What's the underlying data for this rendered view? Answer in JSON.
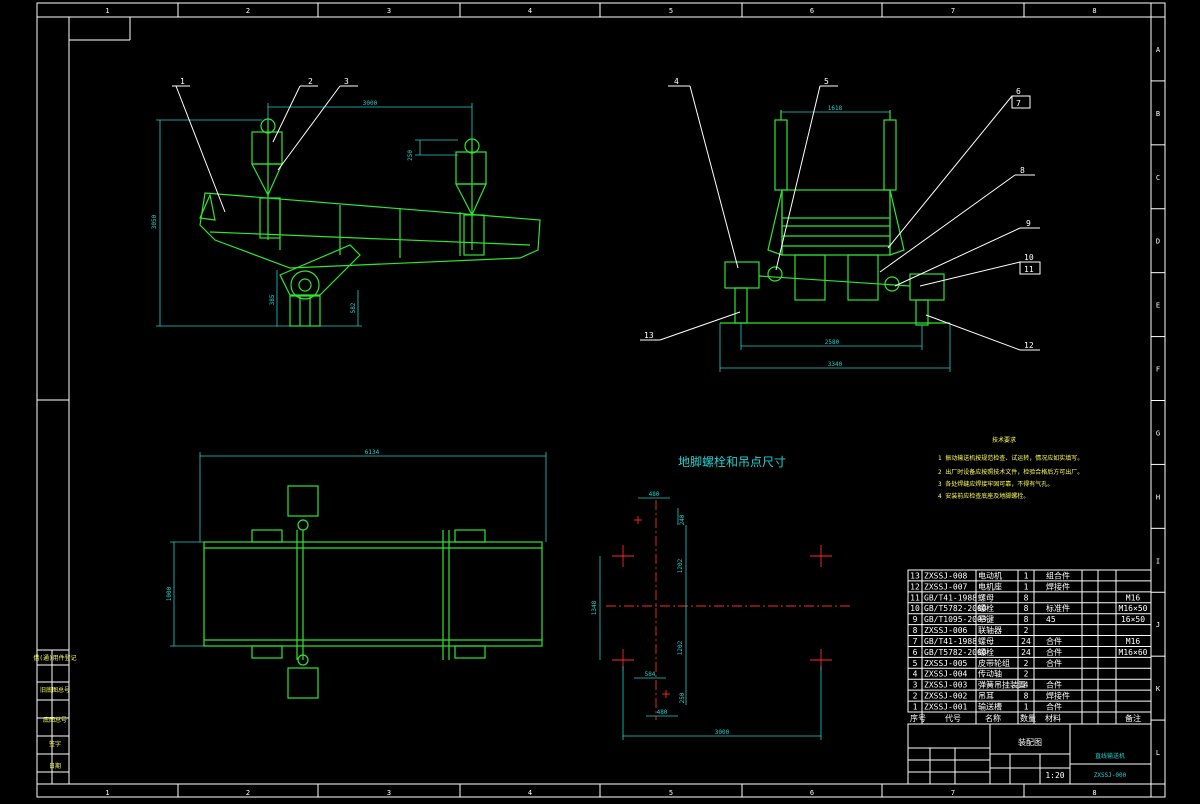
{
  "colors": {
    "background": "#000000",
    "frame": "#ffffff",
    "geometry": "#2ee62e",
    "dimension": "#21d0d0",
    "centerline": "#ff2a2a"
  },
  "top_zone_numbers": [
    "1",
    "2",
    "3",
    "4",
    "5",
    "6",
    "7",
    "8"
  ],
  "side_zone_letters": [
    "A",
    "B",
    "C",
    "D",
    "E",
    "F",
    "G",
    "H",
    "I",
    "J",
    "K",
    "L"
  ],
  "side_view": {
    "dim_top": "3000",
    "dim_offset": "250",
    "dim_height": "3050",
    "dim_foot": "385",
    "dim_foot2": "582"
  },
  "end_view": {
    "dim_top": "1618",
    "dim_mid": "2580",
    "dim_bottom": "3340"
  },
  "plan_view": {
    "dim_length": "6134",
    "dim_width": "1000"
  },
  "callouts": [
    "1",
    "2",
    "3",
    "4",
    "5",
    "6",
    "7",
    "8",
    "9",
    "10",
    "11",
    "12",
    "13"
  ],
  "bolt_layout": {
    "title": "地脚螺栓和吊点尺寸",
    "d1": "480",
    "d2": "240",
    "d3": "1202",
    "d4": "1348",
    "d5": "1202",
    "d6": "584",
    "d7": "250",
    "d8": "480",
    "d9": "3000"
  },
  "notes": {
    "title": "技术要求",
    "items": [
      "1 振动输送机按规范检查、试运转，情况应如实填写。",
      "2 出厂时设备应按照技术文件，检验合格后方可出厂。",
      "3 各处焊缝应焊接牢固可靠，不得有气孔。",
      "4 安装前应检查底座及地脚螺栓。"
    ]
  },
  "bom": {
    "rows": [
      {
        "no": "13",
        "code": "ZXSSJ-008",
        "name": "电动机",
        "qty": "1",
        "mat": "组合件",
        "note": ""
      },
      {
        "no": "12",
        "code": "ZXSSJ-007",
        "name": "电机座",
        "qty": "1",
        "mat": "焊接件",
        "note": ""
      },
      {
        "no": "11",
        "code": "GB/T41-1988",
        "name": "螺母",
        "qty": "8",
        "mat": "",
        "note": "M16"
      },
      {
        "no": "10",
        "code": "GB/T5782-2000",
        "name": "螺栓",
        "qty": "8",
        "mat": "标准件",
        "note": "M16×50"
      },
      {
        "no": "9",
        "code": "GB/T1095-2003",
        "name": "平键",
        "qty": "8",
        "mat": "45",
        "note": "16×50"
      },
      {
        "no": "8",
        "code": "ZXSSJ-006",
        "name": "联轴器",
        "qty": "2",
        "mat": "",
        "note": ""
      },
      {
        "no": "7",
        "code": "GB/T41-1988",
        "name": "螺母",
        "qty": "24",
        "mat": "合件",
        "note": "M16"
      },
      {
        "no": "6",
        "code": "GB/T5782-2000",
        "name": "螺栓",
        "qty": "24",
        "mat": "合件",
        "note": "M16×60"
      },
      {
        "no": "5",
        "code": "ZXSSJ-005",
        "name": "皮带轮组",
        "qty": "2",
        "mat": "合件",
        "note": ""
      },
      {
        "no": "4",
        "code": "ZXSSJ-004",
        "name": "传动轴",
        "qty": "2",
        "mat": "",
        "note": ""
      },
      {
        "no": "3",
        "code": "ZXSSJ-003",
        "name": "弹簧吊挂装置",
        "qty": "4",
        "mat": "合件",
        "note": ""
      },
      {
        "no": "2",
        "code": "ZXSSJ-002",
        "name": "吊耳",
        "qty": "8",
        "mat": "焊接件",
        "note": ""
      },
      {
        "no": "1",
        "code": "ZXSSJ-001",
        "name": "输送槽",
        "qty": "1",
        "mat": "合件",
        "note": ""
      }
    ],
    "header": {
      "no": "序号",
      "code": "代号",
      "name": "名称",
      "qty": "数量",
      "mat": "材料",
      "note": "备注"
    }
  },
  "title_block": {
    "drawing_type": "装配图",
    "product_name": "直线输送机",
    "drawing_no": "ZXSSJ-000",
    "scale": "1:20"
  },
  "left_strip": [
    "借(通)用件登记",
    "旧底图总号",
    "底图总号",
    "签字",
    "日期"
  ]
}
